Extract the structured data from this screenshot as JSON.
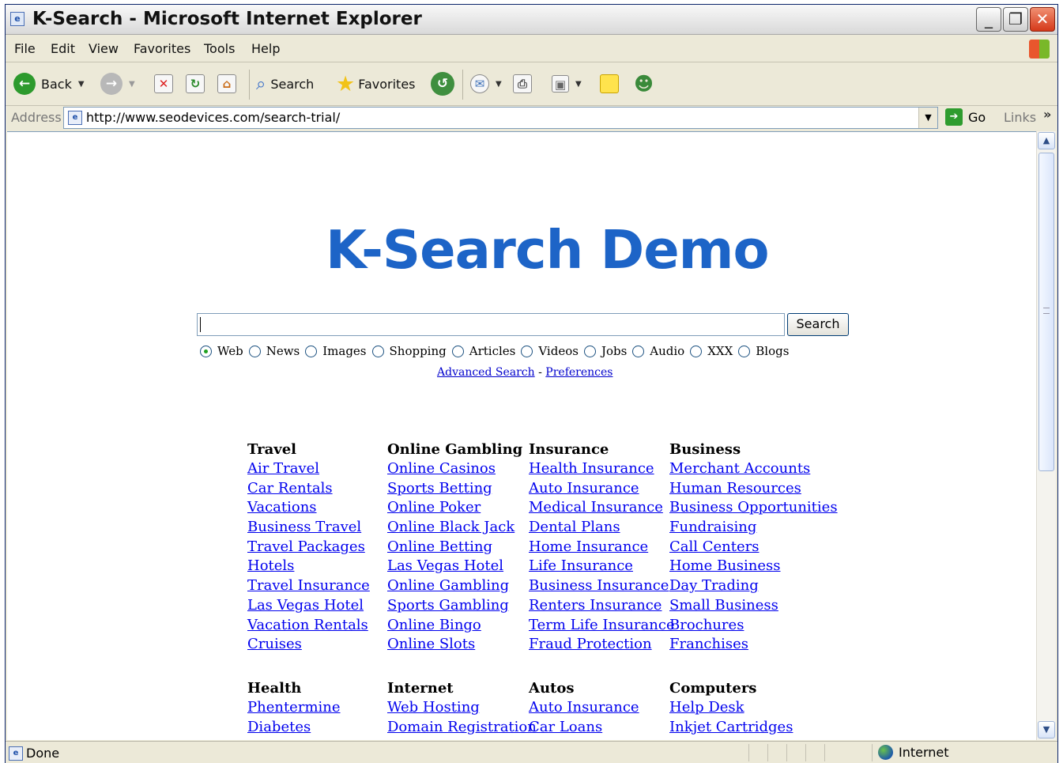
{
  "window": {
    "title": "K-Search - Microsoft Internet Explorer"
  },
  "menu": [
    "File",
    "Edit",
    "View",
    "Favorites",
    "Tools",
    "Help"
  ],
  "toolbar": {
    "back": "Back",
    "search": "Search",
    "favorites": "Favorites"
  },
  "address": {
    "label": "Address",
    "url": "http://www.seodevices.com/search-trial/",
    "go": "Go",
    "links": "Links"
  },
  "page": {
    "logo": "K-Search Demo",
    "search_button": "Search",
    "search_value": "",
    "radio_options": [
      "Web",
      "News",
      "Images",
      "Shopping",
      "Articles",
      "Videos",
      "Jobs",
      "Audio",
      "XXX",
      "Blogs"
    ],
    "selected_option": "Web",
    "advanced_search": "Advanced Search",
    "separator": "-",
    "preferences": "Preferences",
    "categories": [
      {
        "title": "Travel",
        "links": [
          "Air Travel",
          "Car Rentals",
          "Vacations",
          "Business Travel",
          "Travel Packages",
          "Hotels",
          "Travel Insurance",
          "Las Vegas Hotel",
          "Vacation Rentals",
          "Cruises"
        ]
      },
      {
        "title": "Online Gambling",
        "links": [
          "Online Casinos",
          "Sports Betting",
          "Online Poker",
          "Online Black Jack",
          "Online Betting",
          "Las Vegas Hotel",
          "Online Gambling",
          "Sports Gambling",
          "Online Bingo",
          "Online Slots"
        ]
      },
      {
        "title": "Insurance",
        "links": [
          "Health Insurance",
          "Auto Insurance",
          "Medical Insurance",
          "Dental Plans",
          "Home Insurance",
          "Life Insurance",
          "Business Insurance",
          "Renters Insurance",
          "Term Life Insurance",
          "Fraud Protection"
        ]
      },
      {
        "title": "Business",
        "links": [
          "Merchant Accounts",
          "Human Resources",
          "Business Opportunities",
          "Fundraising",
          "Call Centers",
          "Home Business",
          "Day Trading",
          "Small Business",
          "Brochures",
          "Franchises"
        ]
      },
      {
        "title": "Health",
        "links": [
          "Phentermine",
          "Diabetes"
        ]
      },
      {
        "title": "Internet",
        "links": [
          "Web Hosting",
          "Domain Registration"
        ]
      },
      {
        "title": "Autos",
        "links": [
          "Auto Insurance",
          "Car Loans"
        ]
      },
      {
        "title": "Computers",
        "links": [
          "Help Desk",
          "Inkjet Cartridges"
        ]
      }
    ]
  },
  "status": {
    "text": "Done",
    "zone": "Internet"
  },
  "colors": {
    "logo": "#1d64c7",
    "link": "#0000ee",
    "chrome": "#ece9d8"
  }
}
